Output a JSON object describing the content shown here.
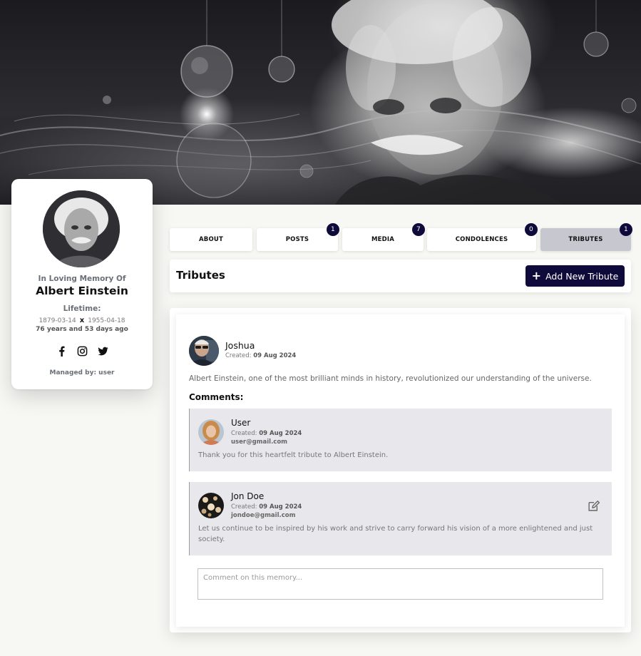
{
  "banner": {
    "alt_subject": "einstein-portrait-banner"
  },
  "profile": {
    "memory_label": "In Loving Memory Of",
    "name": "Albert Einstein",
    "lifetime_label": "Lifetime:",
    "born": "1879-03-14",
    "separator": "x",
    "died": "1955-04-18",
    "age": "76 years and 53 days ago",
    "social_icons": [
      "facebook-icon",
      "instagram-icon",
      "twitter-icon"
    ],
    "managed_by": "Managed by: user"
  },
  "tabs": [
    {
      "label": "ABOUT",
      "badge": ""
    },
    {
      "label": "POSTS",
      "badge": "1"
    },
    {
      "label": "MEDIA",
      "badge": "7"
    },
    {
      "label": "CONDOLENCES",
      "badge": "0"
    },
    {
      "label": "TRIBUTES",
      "badge": "1",
      "active": true
    }
  ],
  "section": {
    "title": "Tributes",
    "add_button_label": "Add New Tribute"
  },
  "tribute": {
    "author": "Joshua",
    "created_label": "Created:",
    "created_date": "09 Aug 2024",
    "body": "Albert Einstein, one of the most brilliant minds in history, revolutionized our understanding of the universe.",
    "comments_label": "Comments:",
    "comments": [
      {
        "name": "User",
        "created_label": "Created:",
        "created_date": "09 Aug 2024",
        "email": "user@gmail.com",
        "text": "Thank you for this heartfelt tribute to Albert Einstein."
      },
      {
        "name": "Jon Doe",
        "created_label": "Created:",
        "created_date": "09 Aug 2024",
        "email": "jondoe@gmail.com",
        "text": "Let us continue to be inspired by his work and strive to carry forward his vision of a more enlightened and just society."
      }
    ],
    "comment_placeholder": "Comment on this memory..."
  },
  "colors": {
    "accent": "#0e0a3a",
    "page_bg": "#f7f7f3",
    "active_tab": "#c7c8cf",
    "comment_bg": "#e8e8ec"
  }
}
